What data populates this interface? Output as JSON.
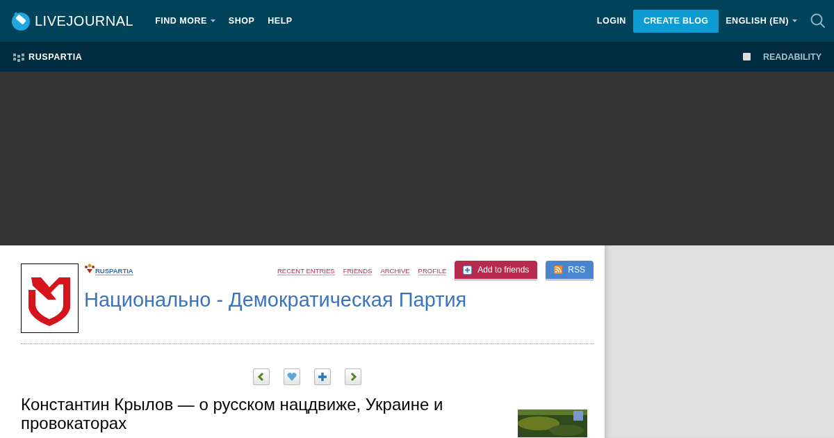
{
  "header": {
    "logo": "LIVEJOURNAL",
    "nav": [
      {
        "label": "FIND MORE",
        "dropdown": true
      },
      {
        "label": "SHOP",
        "dropdown": false
      },
      {
        "label": "HELP",
        "dropdown": false
      }
    ],
    "login": "LOGIN",
    "create": "CREATE BLOG",
    "language": "ENGLISH (EN)"
  },
  "subbar": {
    "journal": "RUSPARTIA",
    "readability": {
      "label": "READABILITY",
      "checked": false
    }
  },
  "journal": {
    "username": "RUSPARTIA",
    "title": "Национально - Демократическая Партия",
    "links": [
      "RECENT ENTRIES",
      "FRIENDS",
      "ARCHIVE",
      "PROFILE"
    ],
    "add_friends": "Add to friends",
    "rss": "RSS"
  },
  "entry_nav": [
    {
      "kind": "prev"
    },
    {
      "kind": "memory"
    },
    {
      "kind": "add"
    },
    {
      "kind": "next"
    }
  ],
  "post": {
    "title": "Константин Крылов — о русском нацдвиже, Украине и провокаторах"
  }
}
